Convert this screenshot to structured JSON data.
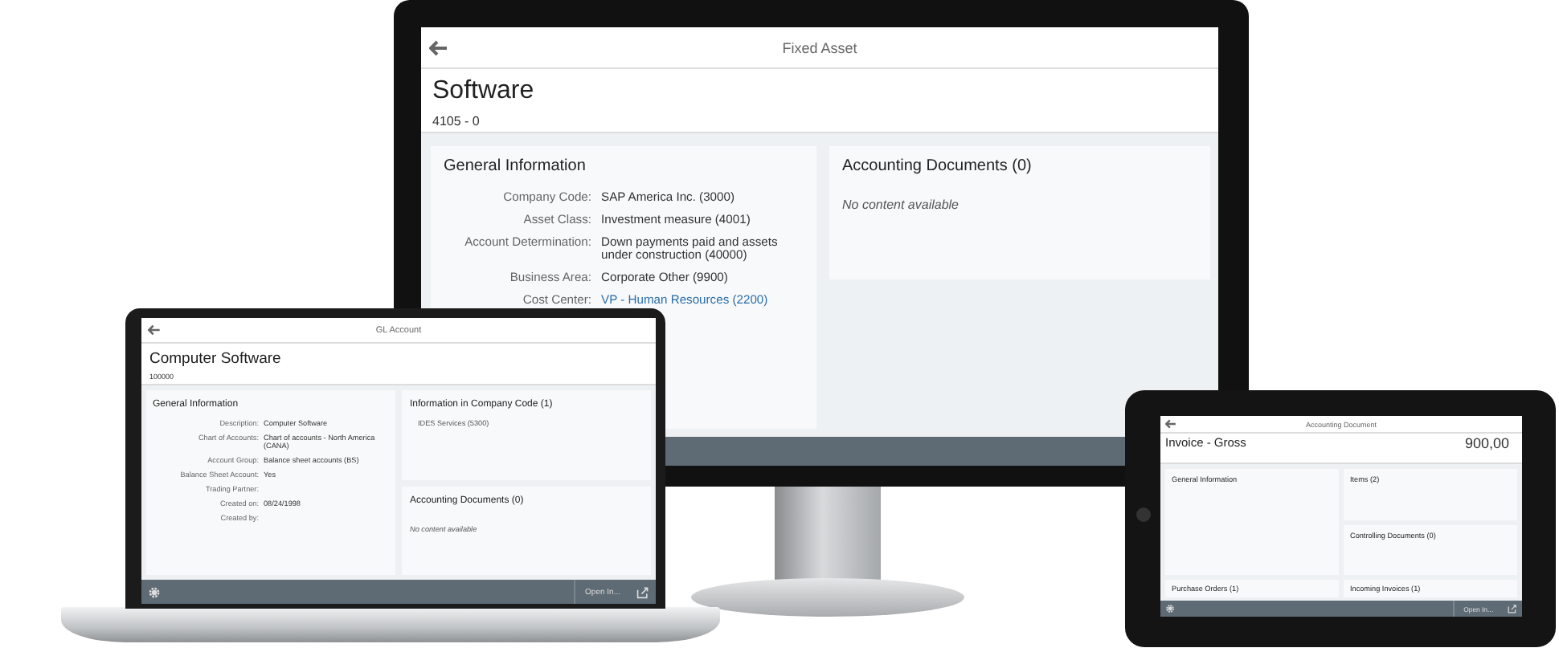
{
  "monitor": {
    "header_title": "Fixed Asset",
    "title": "Software",
    "subtitle": "4105 - 0",
    "general": {
      "title": "General Information",
      "fields": [
        {
          "label": "Company Code:",
          "value": "SAP America Inc. (3000)",
          "link": false
        },
        {
          "label": "Asset Class:",
          "value": "Investment measure (4001)",
          "link": false
        },
        {
          "label": "Account Determination:",
          "value": "Down payments paid and assets under construction (40000)",
          "link": false
        },
        {
          "label": "Business Area:",
          "value": "Corporate Other (9900)",
          "link": false
        },
        {
          "label": "Cost Center:",
          "value": "VP - Human Resources (2200)",
          "link": true
        }
      ]
    },
    "side": [
      {
        "title": "Accounting Documents (0)",
        "empty_text": "No content available"
      }
    ]
  },
  "laptop": {
    "header_title": "GL Account",
    "title": "Computer Software",
    "subtitle": "100000",
    "general": {
      "title": "General Information",
      "fields": [
        {
          "label": "Description:",
          "value": "Computer Software"
        },
        {
          "label": "Chart of Accounts:",
          "value": "Chart of accounts - North America (CANA)"
        },
        {
          "label": "Account Group:",
          "value": "Balance sheet accounts (BS)"
        },
        {
          "label": "Balance Sheet Account:",
          "value": "Yes"
        },
        {
          "label": "Trading Partner:"
        },
        {
          "label": "Created on:",
          "value": "08/24/1998"
        },
        {
          "label": "Created by:"
        }
      ]
    },
    "side": [
      {
        "title": "Information in Company Code (1)",
        "lines": [
          "IDES Services (5300)"
        ]
      },
      {
        "title": "Accounting Documents (0)",
        "empty_text": "No content available"
      }
    ],
    "footer_button": "Open In..."
  },
  "tablet": {
    "header_title": "Accounting Document",
    "title": "Invoice - Gross",
    "amount": "900,00",
    "general": {
      "title": "General Information"
    },
    "side": [
      {
        "title": "Items (2)"
      },
      {
        "title": "Controlling Documents (0)"
      }
    ],
    "bottom": [
      {
        "title": "Purchase Orders (1)"
      },
      {
        "title": "Incoming Invoices (1)"
      }
    ],
    "footer_button": "Open In..."
  }
}
